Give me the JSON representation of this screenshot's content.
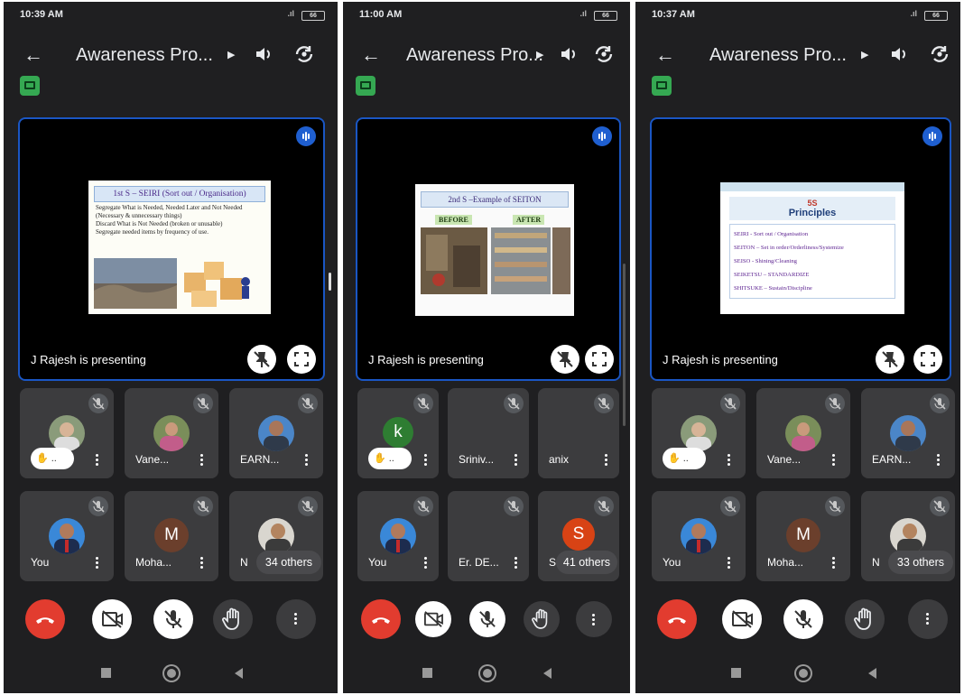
{
  "meeting": {
    "title": "Awareness Pro...",
    "presenter_text": "J Rajesh is presenting"
  },
  "screens": [
    {
      "time": "10:39 AM",
      "battery": "66",
      "slide": {
        "title": "1st S – SEIRI (Sort out / Organisation)",
        "bullets": [
          "Segregate What is Needed, Needed Later and Not Needed (Necessary & unnecessary things)",
          "Discard What is Not Needed (broken or unusable)",
          "Segregate needed items by frequency of use."
        ]
      },
      "tiles": [
        {
          "name": "",
          "raised": "✋ ..",
          "avatar": "photo"
        },
        {
          "name": "Vane...",
          "avatar": "photo"
        },
        {
          "name": "EARN...",
          "avatar": "photo"
        },
        {
          "name": "You",
          "avatar": "photo"
        },
        {
          "name": "Moha...",
          "letter": "M",
          "avatar_color": "#6b3f2c"
        },
        {
          "name": "N",
          "others": "34 others",
          "avatar": "photo"
        }
      ]
    },
    {
      "time": "11:00 AM",
      "battery": "66",
      "slide": {
        "title": "2nd S –Example of SEITON",
        "before": "BEFORE",
        "after": "AFTER"
      },
      "tiles": [
        {
          "name": "",
          "raised": "✋ ..",
          "letter": "k",
          "avatar_color": "#2e7d32"
        },
        {
          "name": "Sriniv..."
        },
        {
          "name": "anix"
        },
        {
          "name": "You",
          "avatar": "photo"
        },
        {
          "name": "Er. DE..."
        },
        {
          "name": "S",
          "others": "41 others",
          "letter": "S",
          "avatar_color": "#d84315"
        }
      ]
    },
    {
      "time": "10:37 AM",
      "battery": "66",
      "slide": {
        "title_num": "5S",
        "title_word": "Principles",
        "items": [
          "SEIRI - Sort out / Organisation",
          "SEITON – Set in order/Orderliness/Systemize",
          "SEISO - Shining/Cleaning",
          "SEIKETSU – STANDARDIZE",
          "SHITSUKE – Sustain/Discipline"
        ]
      },
      "tiles": [
        {
          "name": "",
          "raised": "✋ ..",
          "avatar": "photo"
        },
        {
          "name": "Vane...",
          "avatar": "photo"
        },
        {
          "name": "EARN...",
          "avatar": "photo"
        },
        {
          "name": "You",
          "avatar": "photo"
        },
        {
          "name": "Moha...",
          "letter": "M",
          "avatar_color": "#6b3f2c"
        },
        {
          "name": "N",
          "others": "33 others",
          "avatar": "photo"
        }
      ]
    }
  ],
  "icons": [
    "back-arrow-icon",
    "dropdown-caret-icon",
    "speaker-icon",
    "switch-camera-icon",
    "companion-badge-icon",
    "speaking-indicator-icon",
    "pin-off-icon",
    "fullscreen-icon",
    "mic-off-icon",
    "more-vert-icon",
    "end-call-icon",
    "camera-off-icon",
    "hand-raise-icon",
    "nav-recents-icon",
    "nav-home-icon",
    "nav-back-icon"
  ],
  "colors": {
    "end_call": "#e23c2f",
    "stage_border": "#1a56c4",
    "tile_bg": "#3c3c3e",
    "phone_bg": "#1f1f21"
  }
}
